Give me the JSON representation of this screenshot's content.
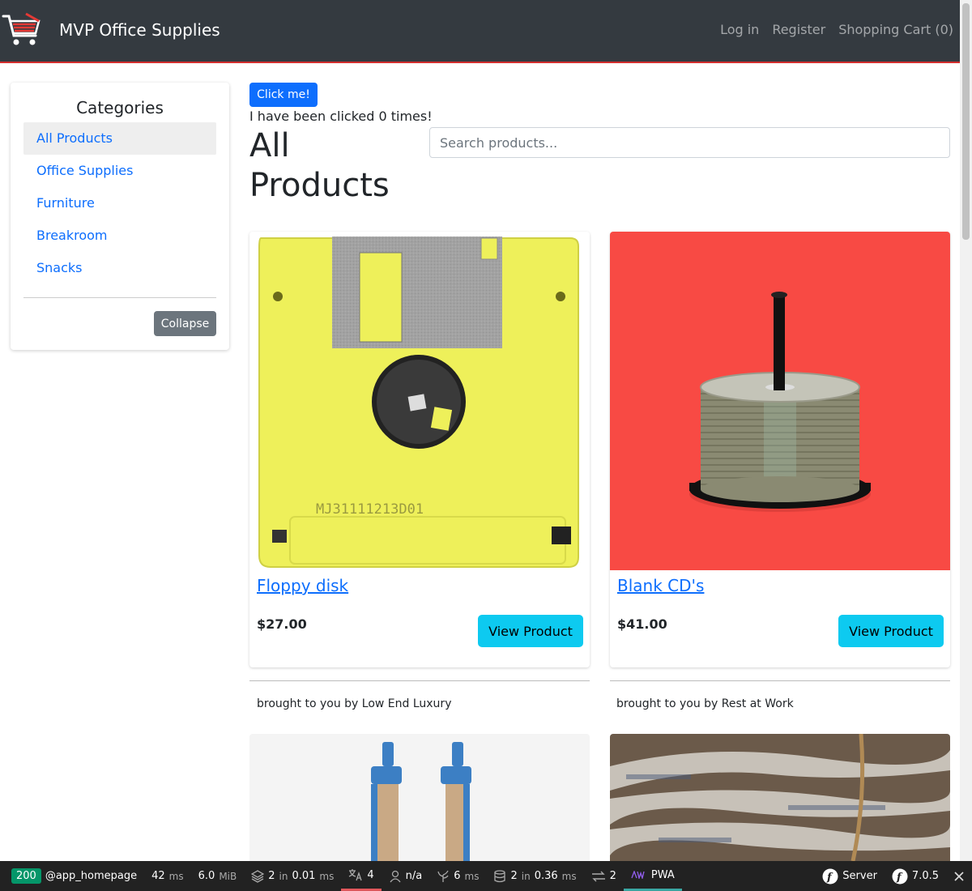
{
  "navbar": {
    "brand": "MVP Office Supplies",
    "links": [
      "Log in",
      "Register",
      "Shopping Cart (0)"
    ]
  },
  "sidebar": {
    "title": "Categories",
    "items": [
      "All Products",
      "Office Supplies",
      "Furniture",
      "Breakroom",
      "Snacks"
    ],
    "active_index": 0,
    "collapse_label": "Collapse"
  },
  "main": {
    "click_button": "Click me!",
    "click_text": "I have been clicked 0 times!",
    "page_title": "All Products",
    "search_placeholder": "Search products...",
    "view_label": "View Product"
  },
  "products": [
    {
      "name": "Floppy disk",
      "price": "$27.00",
      "vendor": "brought to you by Low End Luxury"
    },
    {
      "name": "Blank CD's",
      "price": "$41.00",
      "vendor": "brought to you by Rest at Work"
    }
  ],
  "debug": {
    "status": "200",
    "route": "@app_homepage",
    "time_value": "42",
    "time_unit": "ms",
    "memory_value": "6.0",
    "memory_unit": "MiB",
    "cache_count": "2",
    "cache_in": "in",
    "cache_time": "0.01",
    "cache_unit": "ms",
    "translation_count": "4",
    "user": "n/a",
    "twig_time": "6",
    "twig_unit": "ms",
    "db_count": "2",
    "db_in": "in",
    "db_time": "0.36",
    "db_unit": "ms",
    "http_count": "2",
    "pwa_label": "PWA",
    "server_label": "Server",
    "symfony_version": "7.0.5"
  },
  "colors": {
    "navbar_bg": "#343a40",
    "accent_red": "#d32f2f",
    "primary": "#0d6efd",
    "info": "#0dcaf0",
    "secondary": "#6c757d"
  }
}
